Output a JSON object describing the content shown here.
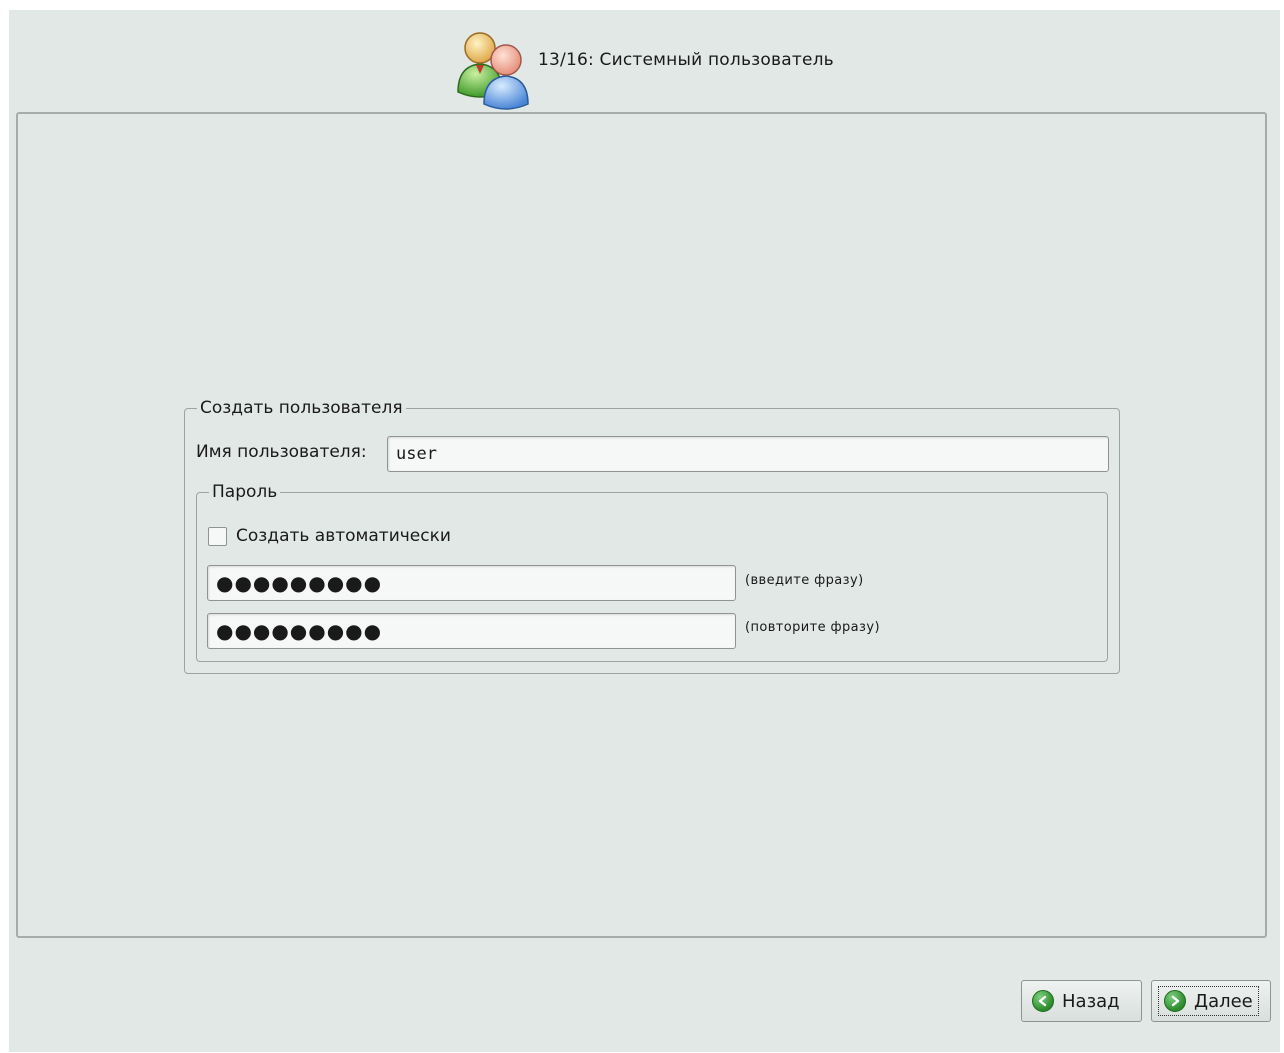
{
  "header": {
    "title": "13/16: Системный пользователь",
    "icon": "users-icon"
  },
  "create_user": {
    "legend": "Создать пользователя",
    "username_label": "Имя пользователя:",
    "username_value": "user",
    "password": {
      "legend": "Пароль",
      "auto_generate_label": "Создать автоматически",
      "auto_generate_checked": false,
      "password_value": "●●●●●●●●●",
      "password_hint": "(введите фразу)",
      "confirm_value": "●●●●●●●●●",
      "confirm_hint": "(повторите фразу)"
    }
  },
  "footer": {
    "back_label": "Назад",
    "next_label": "Далее",
    "back_icon": "arrow-left-icon",
    "next_icon": "arrow-right-icon"
  },
  "colors": {
    "background": "#e2e8e6",
    "button_icon": "#2c8a2c"
  }
}
